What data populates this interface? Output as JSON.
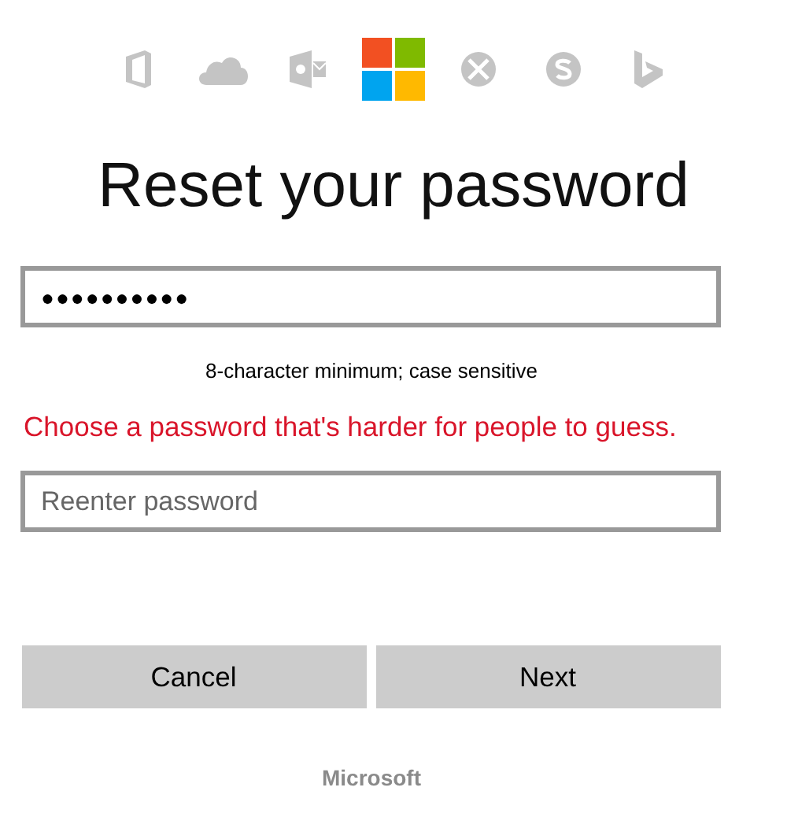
{
  "title": "Reset your password",
  "password_field": {
    "value": "●●●●●●●●●●"
  },
  "hint": "8-character minimum; case sensitive",
  "error": "Choose a password that's harder for people to guess.",
  "confirm_field": {
    "placeholder": "Reenter password"
  },
  "buttons": [
    "Cancel",
    "Next"
  ],
  "footer": "Microsoft"
}
